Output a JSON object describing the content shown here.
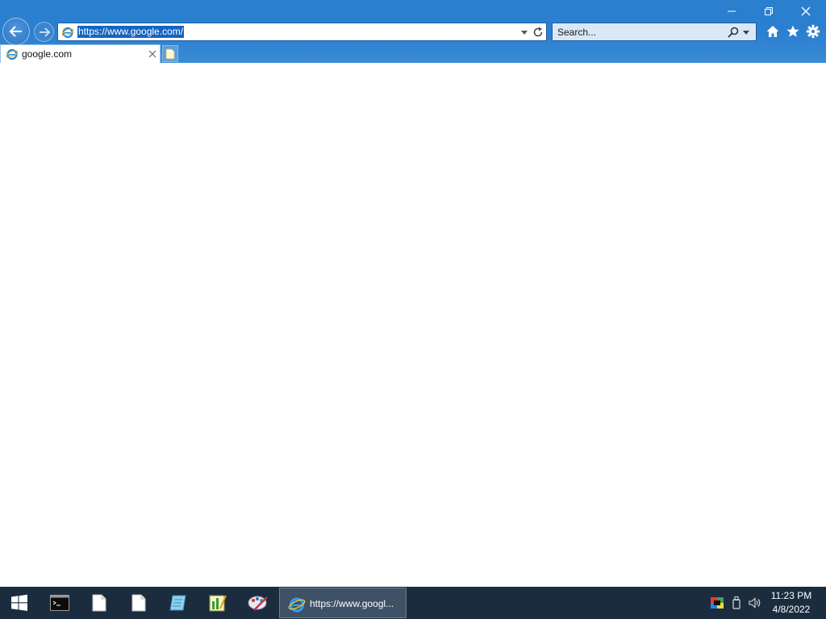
{
  "browser": {
    "address_url": "https://www.google.com/",
    "search_placeholder": "Search...",
    "tab_title": "google.com"
  },
  "colors": {
    "chrome_blue": "#2b7fcf",
    "selection": "#1565c0",
    "taskbar": "#1b2c3e"
  },
  "window_controls": [
    "minimize-icon",
    "restore-icon",
    "close-icon"
  ],
  "toolbar_icons": [
    "home-icon",
    "favorites-star-icon",
    "settings-gear-icon"
  ],
  "taskbar": {
    "pinned": [
      "start-windows-icon",
      "command-prompt-icon",
      "document-icon",
      "document-icon",
      "notepad-icon",
      "spreadsheet-icon",
      "paint-icon"
    ],
    "active_window_label": "https://www.googl...",
    "tray_icons": [
      "color-display-icon",
      "usb-device-icon",
      "volume-icon"
    ],
    "time": "11:23 PM",
    "date": "4/8/2022"
  }
}
